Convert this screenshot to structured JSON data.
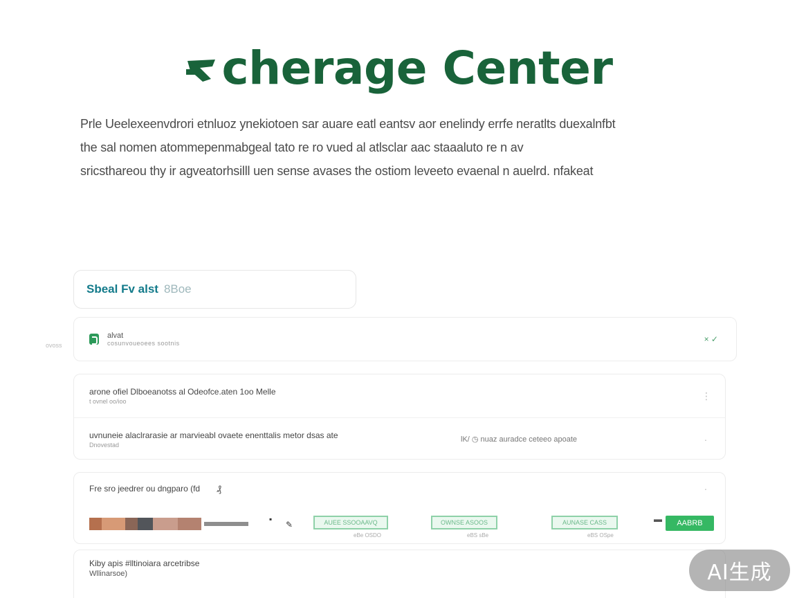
{
  "header": {
    "title": "cherage Center",
    "title_color": "#19633a"
  },
  "intro": {
    "lines": [
      "Prle Ueelexeenvdrori etnluoz ynekiotoen sar auare eatl eantsv aor enelindy errfe neratlts duexalnfbt",
      "the sal nomen atommepenmabgeal tato re ro vued al atlsclar aac staaaluto re n av",
      "sricsthareou thy ir agveatorhsilll uen sense avases the ostiom leveeto evaenal n auelrd. nfakeat"
    ]
  },
  "search": {
    "label": "Sbeal Fv alst",
    "suffix": "8Boe"
  },
  "account": {
    "name": "alvat",
    "sub": "cosunvoueoees sootnis",
    "check": "× ✓",
    "side_label": "ovoss"
  },
  "records": [
    {
      "title": "arone ofiel Dlboeanotss al Odeofce.aten 1oo Melle",
      "sub": "t ovnel oo/ioo",
      "extra": ""
    },
    {
      "title": "uvnuneie alaclrarasie ar marvieabl ovaete enenttalis metor  dsas ate",
      "sub": "Dnovestad",
      "extra": "lK/ ◷ nuaz auradce ceteeo apoate"
    }
  ],
  "plans_section": {
    "title": "Fre sro jeedrer ou dngparo (fd",
    "glyph": "₰",
    "chips": [
      "AUEE SSOOAAVQ",
      "OWNSE ASOOS",
      "AUNASE CASS"
    ],
    "chip_notes": [
      "eBe OSDO",
      "eBS sBe",
      "eBS OSpe"
    ],
    "button_label": "AABRB",
    "swatch_colors": [
      "#b5704e",
      "#d79a76",
      "#8a6657",
      "#52555a",
      "#c99d8d",
      "#b48270",
      "#ffffff",
      "#8e8e8e"
    ],
    "accent_color": "#35b863"
  },
  "bottom_row": {
    "title": "Kiby apis #lltinoiara arcetribse",
    "sub": "Wllinarsoe)"
  },
  "ai_badge": "AI生成"
}
